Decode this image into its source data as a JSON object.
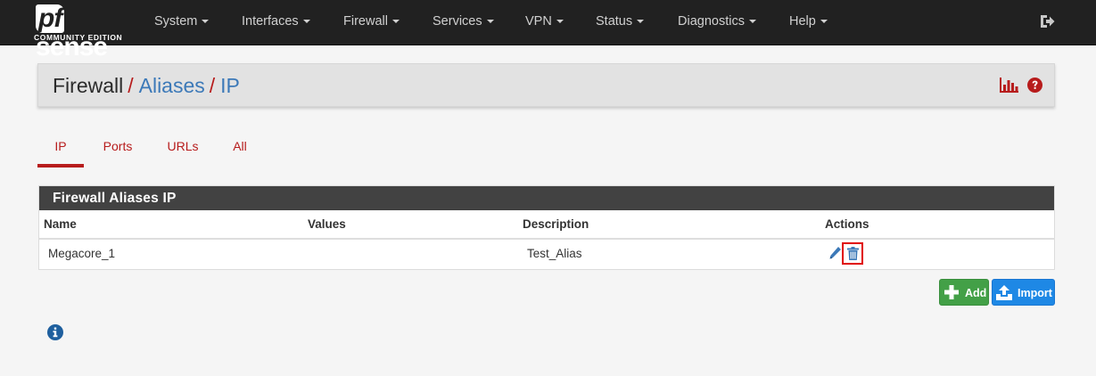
{
  "brand": {
    "logo_pf": "pf",
    "logo_sense": "sense",
    "logo_subtitle": "COMMUNITY EDITION"
  },
  "nav": {
    "items": [
      {
        "label": "System"
      },
      {
        "label": "Interfaces"
      },
      {
        "label": "Firewall"
      },
      {
        "label": "Services"
      },
      {
        "label": "VPN"
      },
      {
        "label": "Status"
      },
      {
        "label": "Diagnostics"
      },
      {
        "label": "Help"
      }
    ],
    "logout_icon": "sign-out-icon"
  },
  "breadcrumb": {
    "items": [
      "Firewall",
      "Aliases",
      "IP"
    ],
    "separator": "/",
    "chart_icon": "bar-chart-icon",
    "help_icon": "question-circle-icon"
  },
  "tabs": [
    {
      "label": "IP",
      "active": true
    },
    {
      "label": "Ports",
      "active": false
    },
    {
      "label": "URLs",
      "active": false
    },
    {
      "label": "All",
      "active": false
    }
  ],
  "table": {
    "title": "Firewall Aliases IP",
    "columns": [
      "Name",
      "Values",
      "Description",
      "Actions"
    ],
    "rows": [
      {
        "name": "Megacore_1",
        "values": "",
        "description": "Test_Alias",
        "actions": [
          "pencil-icon",
          "trash-icon"
        ]
      }
    ]
  },
  "buttons": {
    "add_label": "Add",
    "import_label": "Import"
  },
  "colors": {
    "navbar": "#212121",
    "accent_red": "#b71c1c",
    "link_blue": "#3c79b8",
    "add_green": "#43a047",
    "import_blue": "#1e88e5",
    "highlight": "#e00000"
  },
  "footer": {
    "info_icon": "info-circle-icon"
  }
}
